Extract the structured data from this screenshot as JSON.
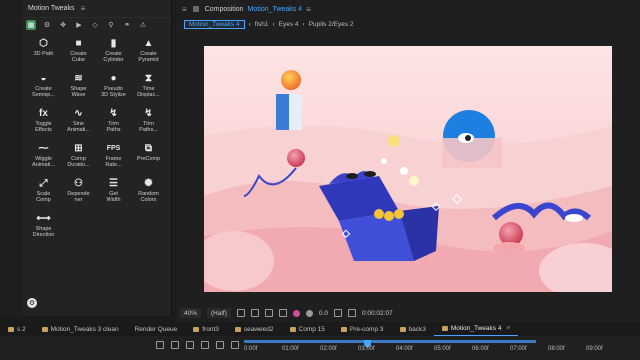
{
  "left_panel": {
    "title": "Motion Tweaks",
    "items": [
      {
        "label": "3D Path",
        "icon": "cube-wire-icon",
        "glyph": "⬡"
      },
      {
        "label": "Create\nCube",
        "icon": "cube-icon",
        "glyph": "■"
      },
      {
        "label": "Create\nCylinder",
        "icon": "cylinder-icon",
        "glyph": "▮"
      },
      {
        "label": "Create\nPyramid",
        "icon": "pyramid-icon",
        "glyph": "▲"
      },
      {
        "label": "Create\nSemisp...",
        "icon": "semisphere-icon",
        "glyph": "◒"
      },
      {
        "label": "Shape\nWave",
        "icon": "wave-icon",
        "glyph": "≋"
      },
      {
        "label": "Pseudo\n3D Stylize",
        "icon": "sphere-icon",
        "glyph": "●"
      },
      {
        "label": "Time\nDisplac...",
        "icon": "time-displace-icon",
        "glyph": "⧗"
      },
      {
        "label": "Toggle\nEffects",
        "icon": "fx-icon",
        "glyph": "fx"
      },
      {
        "label": "Sine\nAnimati...",
        "icon": "sine-icon",
        "glyph": "∿"
      },
      {
        "label": "Trim\nPaths",
        "icon": "trim-paths-icon",
        "glyph": "↯"
      },
      {
        "label": "Trim\nPaths...",
        "icon": "trim-paths-multi-icon",
        "glyph": "↯"
      },
      {
        "label": "Wiggle\nAnimati...",
        "icon": "wiggle-icon",
        "glyph": "⁓"
      },
      {
        "label": "Comp\nDuratio...",
        "icon": "comp-duration-icon",
        "glyph": "⊞"
      },
      {
        "label": "Frame\nRate...",
        "icon": "fps-icon",
        "glyph": "FPS"
      },
      {
        "label": "PreComp",
        "icon": "precomp-icon",
        "glyph": "⧉"
      },
      {
        "label": "Scale\nComp",
        "icon": "scale-comp-icon",
        "glyph": "⤢"
      },
      {
        "label": "Depende\nner",
        "icon": "dependencies-icon",
        "glyph": "⚇"
      },
      {
        "label": "Get\nWidth",
        "icon": "get-width-icon",
        "glyph": "☰"
      },
      {
        "label": "Random\nColors",
        "icon": "random-colors-icon",
        "glyph": "✺"
      },
      {
        "label": "Shape\nDirection",
        "icon": "shape-direction-icon",
        "glyph": "⟷"
      }
    ]
  },
  "composition": {
    "prefix": "Composition",
    "name": "Motion_Tweaks 4",
    "breadcrumbs": [
      "Motion_Tweaks 4",
      "fish1",
      "Eyes 4",
      "Pupils 2/Eyes 2"
    ],
    "zoom": "40%",
    "resolution": "(Half)",
    "timecode": "0:00:02:07"
  },
  "tabs": [
    {
      "label": "s 2",
      "color": "#c8a060"
    },
    {
      "label": "Motion_Tweaks 3 clean",
      "color": "#c8a060"
    },
    {
      "label": "Render Queue",
      "color": ""
    },
    {
      "label": "front3",
      "color": "#c8a060"
    },
    {
      "label": "seaweed2",
      "color": "#c8a060"
    },
    {
      "label": "Comp 15",
      "color": "#c8a060"
    },
    {
      "label": "Pre-comp 3",
      "color": "#c8a060"
    },
    {
      "label": "back3",
      "color": "#c8a060"
    },
    {
      "label": "Motion_Tweaks 4",
      "color": "#c8a060",
      "active": true
    }
  ],
  "timeline": {
    "ticks": [
      "0:00f",
      "01:00f",
      "02:00f",
      "03:00f",
      "04:00f",
      "05:00f",
      "06:00f",
      "07:00f",
      "08:00f",
      "09:00f"
    ]
  }
}
